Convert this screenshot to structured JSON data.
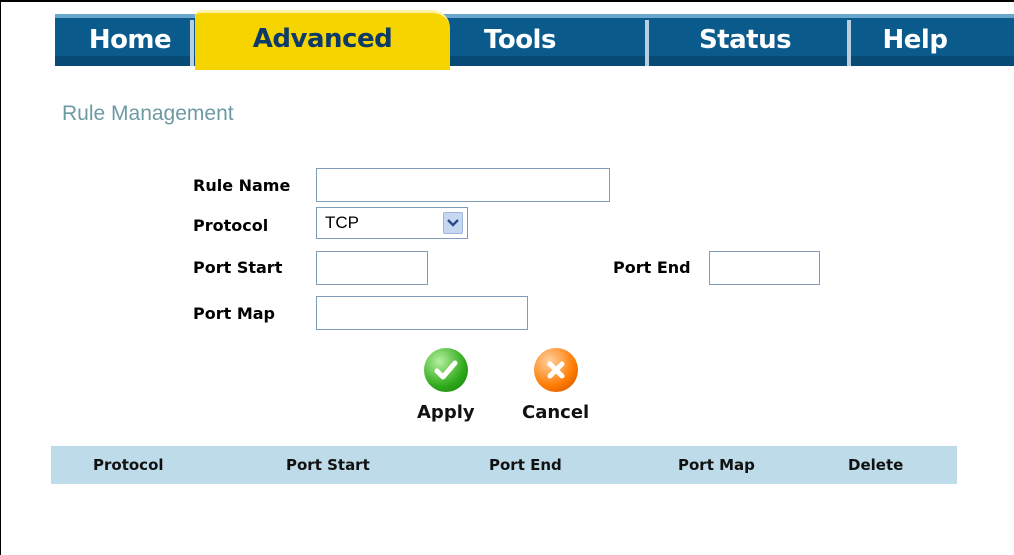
{
  "tabs": [
    {
      "label": "Home"
    },
    {
      "label": "Advanced",
      "active": true
    },
    {
      "label": "Tools"
    },
    {
      "label": "Status"
    },
    {
      "label": "Help"
    }
  ],
  "page_title": "Rule Management",
  "form": {
    "rule_name_label": "Rule Name",
    "rule_name_value": "",
    "protocol_label": "Protocol",
    "protocol_value": "TCP",
    "port_start_label": "Port Start",
    "port_start_value": "",
    "port_end_label": "Port End",
    "port_end_value": "",
    "port_map_label": "Port Map",
    "port_map_value": ""
  },
  "actions": {
    "apply_label": "Apply",
    "cancel_label": "Cancel"
  },
  "table": {
    "columns": [
      "Protocol",
      "Port Start",
      "Port End",
      "Port Map",
      "Delete"
    ],
    "rows": []
  },
  "colors": {
    "tab_bar": "#0a5a8c",
    "active_tab": "#f5d400",
    "title": "#6d9aa3",
    "table_header": "#bedbe9"
  },
  "icons": {
    "apply": "check-icon",
    "cancel": "x-icon",
    "dropdown": "chevron-down-icon"
  }
}
